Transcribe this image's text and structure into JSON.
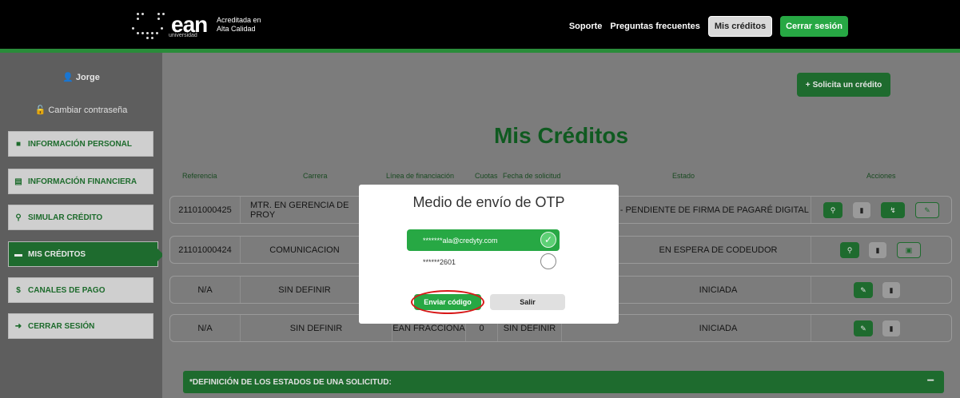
{
  "header": {
    "logo_text": "ean",
    "logo_sub": "universidad",
    "accreditation_line1": "Acreditada en",
    "accreditation_line2": "Alta Calidad",
    "nav_soporte": "Soporte",
    "nav_faq": "Preguntas frecuentes",
    "nav_mis_creditos": "Mis créditos",
    "nav_cerrar": "Cerrar sesión"
  },
  "sidebar": {
    "user_name": "Jorge",
    "change_password": "Cambiar contraseña",
    "items": [
      {
        "label": "INFORMACIÓN PERSONAL"
      },
      {
        "label": "INFORMACIÓN FINANCIERA"
      },
      {
        "label": "SIMULAR CRÉDITO"
      },
      {
        "label": "MIS CRÉDITOS"
      },
      {
        "label": "CANALES DE PAGO"
      },
      {
        "label": "CERRAR SESIÓN"
      }
    ]
  },
  "main": {
    "solicita_button": "Solicita un crédito",
    "title": "Mis Créditos",
    "columns": [
      "Referencia",
      "Carrera",
      "Línea de financiación",
      "Cuotas",
      "Fecha de solicitud",
      "Estado",
      "Acciones"
    ],
    "rows": [
      {
        "ref": "21101000425",
        "carrera": "MTR. EN GERENCIA DE PROY",
        "estado": "DA - PENDIENTE DE FIRMA DE PAGARÉ DIGITAL"
      },
      {
        "ref": "21101000424",
        "carrera": "COMUNICACION",
        "estado": "EN ESPERA DE CODEUDOR"
      },
      {
        "ref": "N/A",
        "carrera": "SIN DEFINIR",
        "estado": "INICIADA"
      },
      {
        "ref": "N/A",
        "carrera": "SIN DEFINIR",
        "linea": "EAN FRACCIONA",
        "cuotas": "0",
        "fecha": "SIN DEFINIR",
        "estado": "INICIADA"
      }
    ],
    "status_bar": "*DEFINICIÓN DE LOS ESTADOS DE UNA SOLICITUD:",
    "status_toggle": "−"
  },
  "modal": {
    "title": "Medio de envío de OTP",
    "options": [
      {
        "label": "*******ala@credyty.com",
        "selected": true
      },
      {
        "label": "******2601",
        "selected": false
      }
    ],
    "send_button": "Enviar código",
    "exit_button": "Salir"
  },
  "colors": {
    "brand_green": "#27a844",
    "dark_green": "#1e6b2e",
    "highlight_ring": "#d71818"
  }
}
